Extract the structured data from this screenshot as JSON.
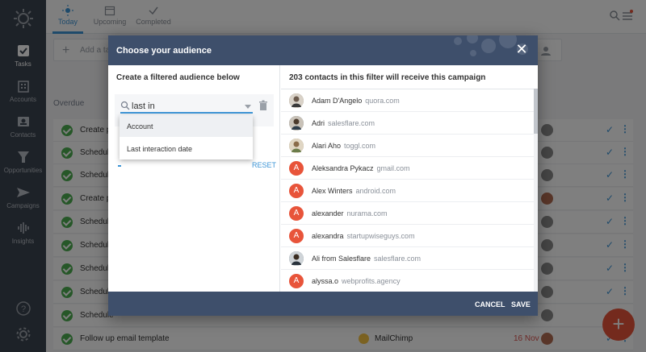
{
  "sidebar": {
    "items": [
      {
        "label": "Tasks",
        "icon": "check-square-icon"
      },
      {
        "label": "Accounts",
        "icon": "building-icon"
      },
      {
        "label": "Contacts",
        "icon": "contact-card-icon"
      },
      {
        "label": "Opportunities",
        "icon": "funnel-icon"
      },
      {
        "label": "Campaigns",
        "icon": "paper-plane-icon"
      },
      {
        "label": "Insights",
        "icon": "waveform-icon"
      }
    ]
  },
  "topbar": {
    "tabs": [
      {
        "label": "Today",
        "icon": "sun-icon"
      },
      {
        "label": "Upcoming",
        "icon": "calendar-icon"
      },
      {
        "label": "Completed",
        "icon": "checkmark-icon"
      }
    ]
  },
  "main": {
    "add_task_placeholder": "Add a task",
    "overdue_label": "Overdue",
    "tasks": [
      {
        "text": "Create pr"
      },
      {
        "text": "Schedule"
      },
      {
        "text": "Schedule"
      },
      {
        "text": "Create pr"
      },
      {
        "text": "Schedule"
      },
      {
        "text": "Schedule"
      },
      {
        "text": "Schedule"
      },
      {
        "text": "Schedule"
      },
      {
        "text": "Schedule"
      },
      {
        "text": "Follow up email template",
        "company": "MailChimp",
        "date": "16 Nov"
      }
    ]
  },
  "modal": {
    "title": "Choose your audience",
    "left_heading": "Create a filtered audience below",
    "search_value": "last in",
    "reset_label": "RESET",
    "dropdown_options": [
      "Account",
      "Last interaction date"
    ],
    "right_heading": "203 contacts in this filter will receive this campaign",
    "contacts": [
      {
        "name": "Adam D'Angelo",
        "domain": "quora.com",
        "initial": "",
        "color": "#7a6a5c",
        "photo": true
      },
      {
        "name": "Adri",
        "domain": "salesflare.com",
        "initial": "",
        "color": "#5b6f7d",
        "photo": true
      },
      {
        "name": "Alari Aho",
        "domain": "toggl.com",
        "initial": "",
        "color": "#8d7b62",
        "photo": true
      },
      {
        "name": "Aleksandra Pykacz",
        "domain": "gmail.com",
        "initial": "A",
        "color": "#e8543a",
        "photo": false
      },
      {
        "name": "Alex Winters",
        "domain": "android.com",
        "initial": "A",
        "color": "#e8543a",
        "photo": false
      },
      {
        "name": "alexander",
        "domain": "nurama.com",
        "initial": "A",
        "color": "#e8543a",
        "photo": false
      },
      {
        "name": "alexandra",
        "domain": "startupwiseguys.com",
        "initial": "A",
        "color": "#e8543a",
        "photo": false
      },
      {
        "name": "Ali from Salesflare",
        "domain": "salesflare.com",
        "initial": "",
        "color": "#556270",
        "photo": true
      },
      {
        "name": "alyssa.o",
        "domain": "webprofits.agency",
        "initial": "A",
        "color": "#e8543a",
        "photo": false
      }
    ],
    "cancel_label": "CANCEL",
    "save_label": "SAVE"
  },
  "colors": {
    "accent": "#3d95d6",
    "modal_header": "#3e4f6b",
    "sidebar": "#3b4450",
    "fab": "#e8543a",
    "success": "#4caf50"
  }
}
